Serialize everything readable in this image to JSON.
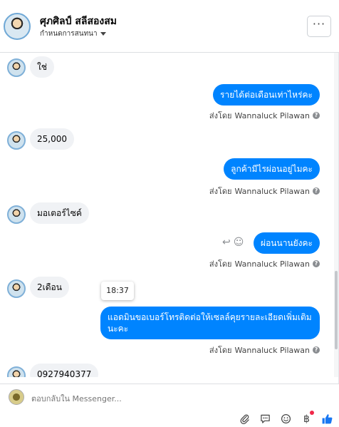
{
  "header": {
    "contact_name": "ศุภศิลป์ สลีสองสม",
    "subtitle": "กำหนดการสนทนา",
    "more_label": "···"
  },
  "messages": {
    "in_1": "ใช่",
    "out_1": "รายได้ต่อเดือนเท่าไหร่คะ",
    "in_2": "25,000",
    "out_2": "ลูกค้ามีไรผ่อนอยู่ไมคะ",
    "in_3": "มอเตอร์ไซค์",
    "out_3": "ผ่อนนานยังคะ",
    "in_4": "2เดือน",
    "out_4": "แอดมินขอเบอร์โทรติดต่อให้เซลล์คุยรายละเอียดเพิ่มเติมนะคะ",
    "in_5": "0927940377",
    "sent_by": "ส่งโดย",
    "sender_name": "Wannaluck Pilawan",
    "timestamp_tooltip": "18:37"
  },
  "composer": {
    "placeholder": "ตอบกลับใน Messenger..."
  },
  "colors": {
    "outgoing_bubble": "#0084ff",
    "incoming_bubble": "#f0f2f5",
    "like_icon": "#1877f2"
  },
  "icons": [
    "chevron-down-icon",
    "more-icon",
    "info-icon",
    "reply-icon",
    "emoji-icon",
    "attachment-icon",
    "saved-replies-icon",
    "emoji-icon",
    "payment-icon",
    "thumbs-up-icon"
  ]
}
